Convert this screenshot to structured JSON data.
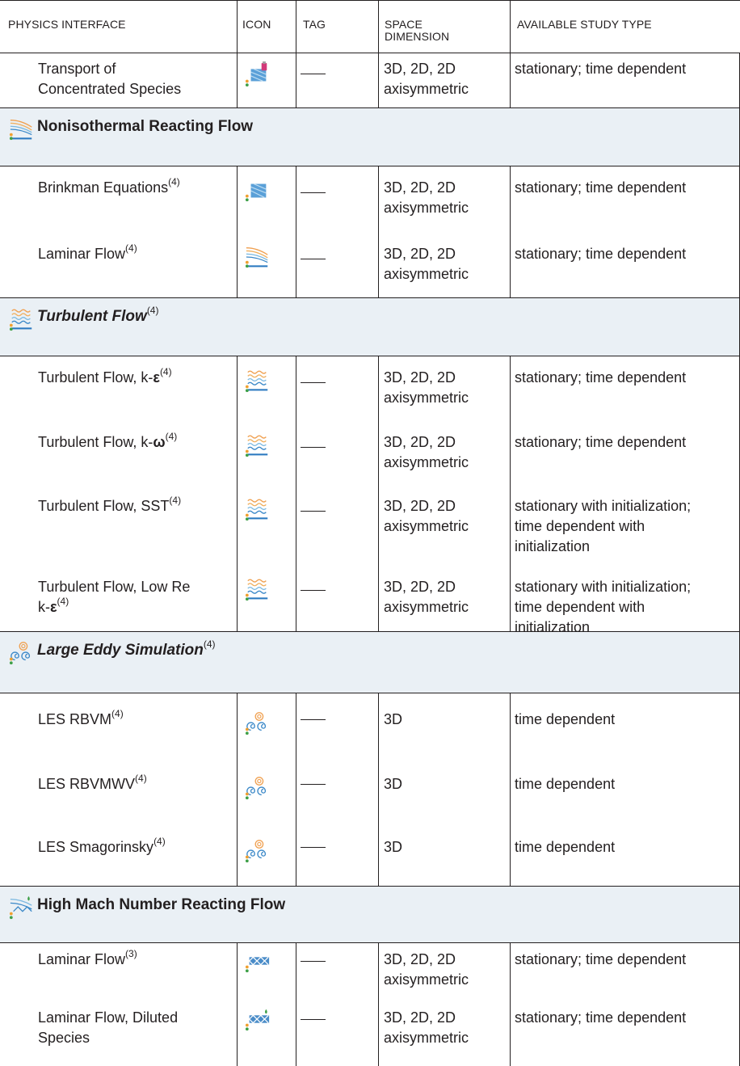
{
  "headers": {
    "physics_interface": "PHYSICS INTERFACE",
    "icon": "ICON",
    "tag": "TAG",
    "space_dimension_line1": "SPACE",
    "space_dimension_line2": "DIMENSION",
    "available_study_type": "AVAILABLE STUDY TYPE"
  },
  "common": {
    "dash": "—",
    "dims_3d2d_line1": "3D, 2D, 2D",
    "dims_3d2d_line2": "axisymmetric",
    "dims_3d": "3D",
    "stationary_time": "stationary; time dependent",
    "time_dependent": "time dependent",
    "init_line1": "stationary with initialization;",
    "init_line2": "time dependent with",
    "init_line3": "initialization",
    "sup4": "(4)",
    "sup3": "(3)"
  },
  "rows": {
    "transport": {
      "line1": "Transport of",
      "line2": "Concentrated Species",
      "icon": "transport-concentrated-species-icon"
    },
    "sec_nonisothermal": {
      "title": "Nonisothermal Reacting Flow",
      "icon": "laminar-flow-icon"
    },
    "brinkman": {
      "name": "Brinkman Equations",
      "icon": "brinkman-icon"
    },
    "laminar": {
      "name": "Laminar Flow",
      "icon": "laminar-flow-icon"
    },
    "sec_turbulent": {
      "title": "Turbulent Flow",
      "icon": "turbulent-flow-icon"
    },
    "keps": {
      "name": "Turbulent Flow, k-",
      "sym": "ε",
      "icon": "turbulent-flow-icon"
    },
    "komega": {
      "name": "Turbulent Flow, k-",
      "sym": "ω",
      "icon": "turbulent-flow-icon"
    },
    "sst": {
      "name": "Turbulent Flow, SST",
      "icon": "turbulent-flow-icon"
    },
    "lowre": {
      "line1": "Turbulent Flow, Low Re",
      "line2": "k-",
      "sym": "ε",
      "icon": "turbulent-flow-icon"
    },
    "sec_les": {
      "title": "Large Eddy Simulation",
      "icon": "les-icon"
    },
    "les_rbvm": {
      "name": "LES RBVM",
      "icon": "les-icon"
    },
    "les_rbvmwv": {
      "name": "LES RBVMWV",
      "icon": "les-icon"
    },
    "les_smag": {
      "name": "LES Smagorinsky",
      "icon": "les-icon"
    },
    "sec_highmach": {
      "title": "High Mach Number Reacting Flow",
      "icon": "high-mach-flow-icon"
    },
    "hm_laminar": {
      "name": "Laminar Flow",
      "icon": "high-mach-laminar-icon"
    },
    "hm_diluted": {
      "line1": "Laminar Flow, Diluted",
      "line2": "Species",
      "icon": "high-mach-diluted-icon"
    }
  },
  "colors": {
    "section_bg": "#eaf0f5",
    "rule": "#231f20",
    "flow_orange": "#f0a050",
    "flow_blue": "#3a88c8"
  }
}
